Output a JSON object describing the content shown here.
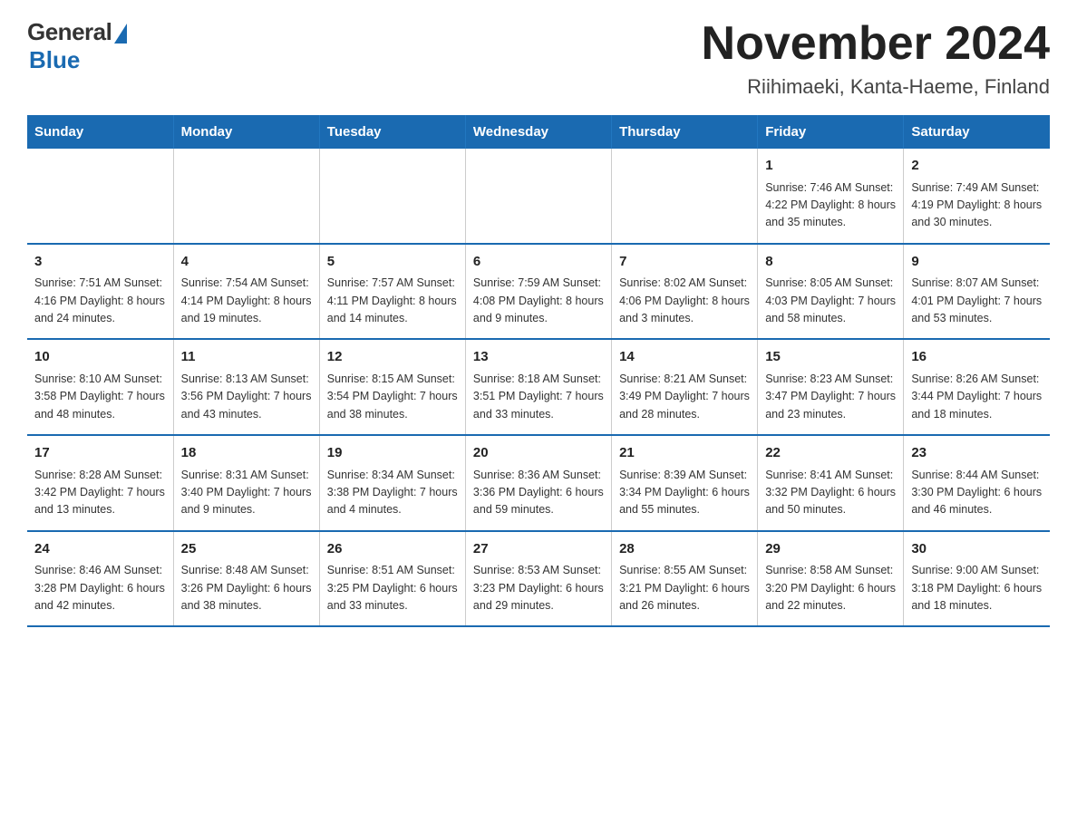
{
  "header": {
    "logo_general": "General",
    "logo_blue": "Blue",
    "main_title": "November 2024",
    "subtitle": "Riihimaeki, Kanta-Haeme, Finland"
  },
  "days_of_week": [
    "Sunday",
    "Monday",
    "Tuesday",
    "Wednesday",
    "Thursday",
    "Friday",
    "Saturday"
  ],
  "weeks": [
    {
      "days": [
        {
          "num": "",
          "info": ""
        },
        {
          "num": "",
          "info": ""
        },
        {
          "num": "",
          "info": ""
        },
        {
          "num": "",
          "info": ""
        },
        {
          "num": "",
          "info": ""
        },
        {
          "num": "1",
          "info": "Sunrise: 7:46 AM\nSunset: 4:22 PM\nDaylight: 8 hours and 35 minutes."
        },
        {
          "num": "2",
          "info": "Sunrise: 7:49 AM\nSunset: 4:19 PM\nDaylight: 8 hours and 30 minutes."
        }
      ]
    },
    {
      "days": [
        {
          "num": "3",
          "info": "Sunrise: 7:51 AM\nSunset: 4:16 PM\nDaylight: 8 hours and 24 minutes."
        },
        {
          "num": "4",
          "info": "Sunrise: 7:54 AM\nSunset: 4:14 PM\nDaylight: 8 hours and 19 minutes."
        },
        {
          "num": "5",
          "info": "Sunrise: 7:57 AM\nSunset: 4:11 PM\nDaylight: 8 hours and 14 minutes."
        },
        {
          "num": "6",
          "info": "Sunrise: 7:59 AM\nSunset: 4:08 PM\nDaylight: 8 hours and 9 minutes."
        },
        {
          "num": "7",
          "info": "Sunrise: 8:02 AM\nSunset: 4:06 PM\nDaylight: 8 hours and 3 minutes."
        },
        {
          "num": "8",
          "info": "Sunrise: 8:05 AM\nSunset: 4:03 PM\nDaylight: 7 hours and 58 minutes."
        },
        {
          "num": "9",
          "info": "Sunrise: 8:07 AM\nSunset: 4:01 PM\nDaylight: 7 hours and 53 minutes."
        }
      ]
    },
    {
      "days": [
        {
          "num": "10",
          "info": "Sunrise: 8:10 AM\nSunset: 3:58 PM\nDaylight: 7 hours and 48 minutes."
        },
        {
          "num": "11",
          "info": "Sunrise: 8:13 AM\nSunset: 3:56 PM\nDaylight: 7 hours and 43 minutes."
        },
        {
          "num": "12",
          "info": "Sunrise: 8:15 AM\nSunset: 3:54 PM\nDaylight: 7 hours and 38 minutes."
        },
        {
          "num": "13",
          "info": "Sunrise: 8:18 AM\nSunset: 3:51 PM\nDaylight: 7 hours and 33 minutes."
        },
        {
          "num": "14",
          "info": "Sunrise: 8:21 AM\nSunset: 3:49 PM\nDaylight: 7 hours and 28 minutes."
        },
        {
          "num": "15",
          "info": "Sunrise: 8:23 AM\nSunset: 3:47 PM\nDaylight: 7 hours and 23 minutes."
        },
        {
          "num": "16",
          "info": "Sunrise: 8:26 AM\nSunset: 3:44 PM\nDaylight: 7 hours and 18 minutes."
        }
      ]
    },
    {
      "days": [
        {
          "num": "17",
          "info": "Sunrise: 8:28 AM\nSunset: 3:42 PM\nDaylight: 7 hours and 13 minutes."
        },
        {
          "num": "18",
          "info": "Sunrise: 8:31 AM\nSunset: 3:40 PM\nDaylight: 7 hours and 9 minutes."
        },
        {
          "num": "19",
          "info": "Sunrise: 8:34 AM\nSunset: 3:38 PM\nDaylight: 7 hours and 4 minutes."
        },
        {
          "num": "20",
          "info": "Sunrise: 8:36 AM\nSunset: 3:36 PM\nDaylight: 6 hours and 59 minutes."
        },
        {
          "num": "21",
          "info": "Sunrise: 8:39 AM\nSunset: 3:34 PM\nDaylight: 6 hours and 55 minutes."
        },
        {
          "num": "22",
          "info": "Sunrise: 8:41 AM\nSunset: 3:32 PM\nDaylight: 6 hours and 50 minutes."
        },
        {
          "num": "23",
          "info": "Sunrise: 8:44 AM\nSunset: 3:30 PM\nDaylight: 6 hours and 46 minutes."
        }
      ]
    },
    {
      "days": [
        {
          "num": "24",
          "info": "Sunrise: 8:46 AM\nSunset: 3:28 PM\nDaylight: 6 hours and 42 minutes."
        },
        {
          "num": "25",
          "info": "Sunrise: 8:48 AM\nSunset: 3:26 PM\nDaylight: 6 hours and 38 minutes."
        },
        {
          "num": "26",
          "info": "Sunrise: 8:51 AM\nSunset: 3:25 PM\nDaylight: 6 hours and 33 minutes."
        },
        {
          "num": "27",
          "info": "Sunrise: 8:53 AM\nSunset: 3:23 PM\nDaylight: 6 hours and 29 minutes."
        },
        {
          "num": "28",
          "info": "Sunrise: 8:55 AM\nSunset: 3:21 PM\nDaylight: 6 hours and 26 minutes."
        },
        {
          "num": "29",
          "info": "Sunrise: 8:58 AM\nSunset: 3:20 PM\nDaylight: 6 hours and 22 minutes."
        },
        {
          "num": "30",
          "info": "Sunrise: 9:00 AM\nSunset: 3:18 PM\nDaylight: 6 hours and 18 minutes."
        }
      ]
    }
  ]
}
